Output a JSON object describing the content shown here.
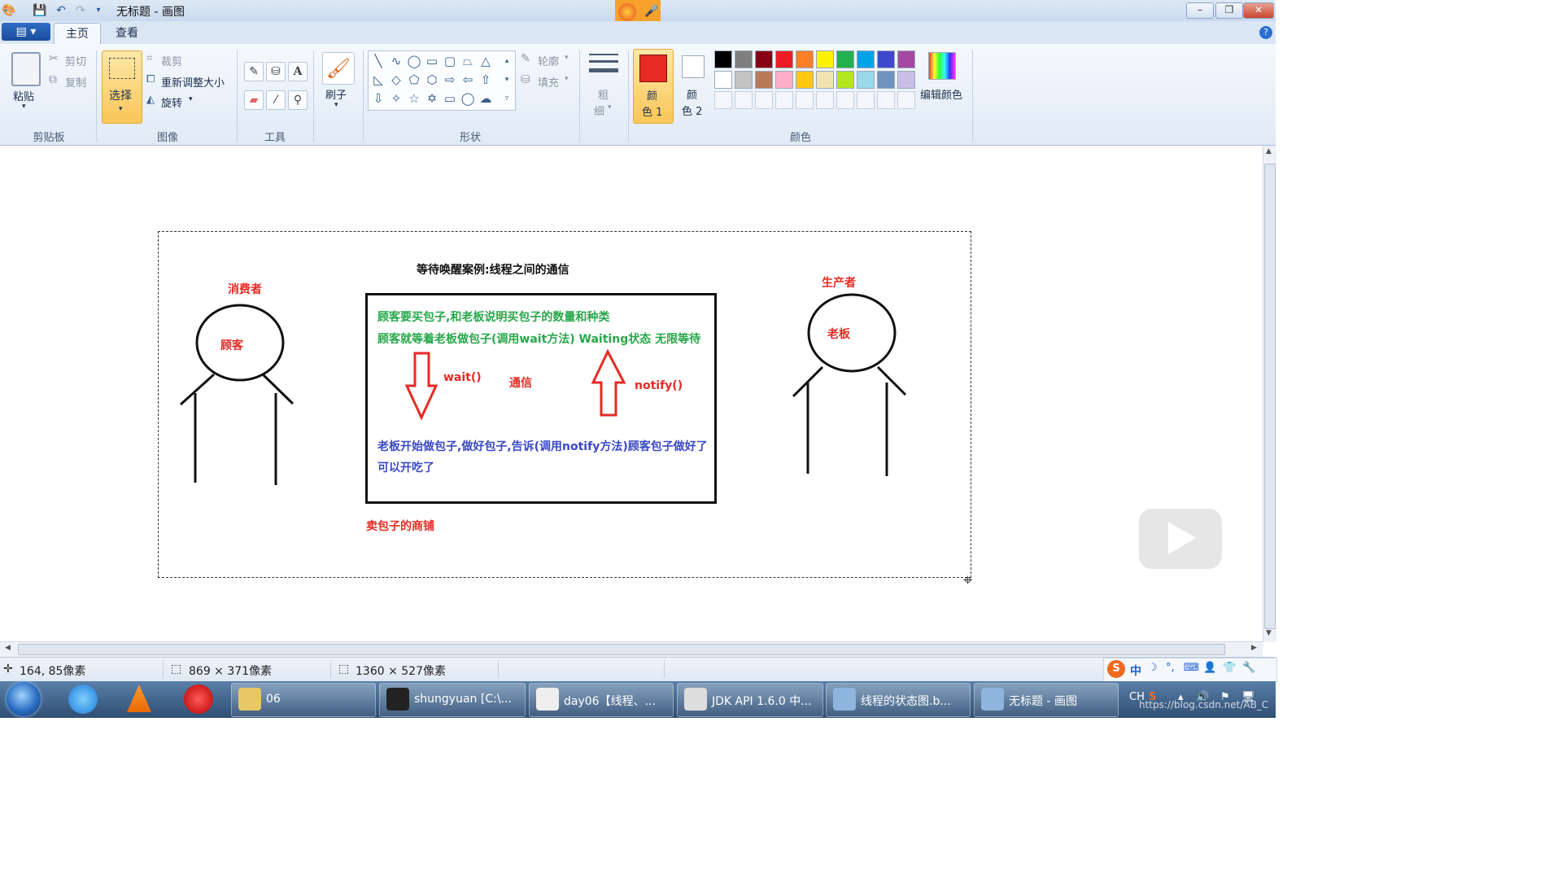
{
  "window": {
    "title": "无标题 - 画图",
    "controls": {
      "minimize": "–",
      "maximize": "❐",
      "close": "✕"
    }
  },
  "quick_access": {
    "icons": [
      "paint-app-icon",
      "save-icon",
      "undo-icon",
      "redo-icon",
      "customize-icon"
    ]
  },
  "ribbon_tabs": [
    {
      "label": "主页",
      "active": true
    },
    {
      "label": "查看",
      "active": false
    }
  ],
  "help_glyph": "?",
  "groups": {
    "clipboard": {
      "label": "剪贴板",
      "paste": "粘贴",
      "cut": "剪切",
      "copy": "复制"
    },
    "image": {
      "label": "图像",
      "select": "选择",
      "crop": "裁剪",
      "resize": "重新调整大小",
      "rotate": "旋转"
    },
    "tools": {
      "label": "工具"
    },
    "brushes": {
      "label": "刷子"
    },
    "shapes": {
      "label": "形状",
      "outline": "轮廓",
      "fill": "填充"
    },
    "size": {
      "label_top": "粗",
      "label_bottom": "细"
    },
    "colors": {
      "label": "颜色",
      "color1_top": "颜",
      "color1_bottom": "色 1",
      "color2_top": "颜",
      "color2_bottom": "色 2",
      "edit_colors": "编辑颜色",
      "color1_value": "#e52b24",
      "color2_value": "#ffffff",
      "palette_row1": [
        "#000000",
        "#7f7f7f",
        "#880015",
        "#ed1c24",
        "#ff7f27",
        "#fff200",
        "#22b14c",
        "#00a2e8",
        "#3f48cc",
        "#a349a4"
      ],
      "palette_row2": [
        "#ffffff",
        "#c3c3c3",
        "#b97a57",
        "#ffaec9",
        "#ffc90e",
        "#efe4b0",
        "#b5e61d",
        "#99d9ea",
        "#7092be",
        "#c8bfe7"
      ]
    }
  },
  "drawing": {
    "title": "等待唤醒案例:线程之间的通信",
    "consumer_label": "消费者",
    "consumer_name": "顾客",
    "producer_label": "生产者",
    "producer_name": "老板",
    "line1": "顾客要买包子,和老板说明买包子的数量和种类",
    "line2": "顾客就等着老板做包子(调用wait方法)  Waiting状态 无限等待",
    "wait_label": "wait()",
    "comm_label": "通信",
    "notify_label": "notify()",
    "line3": "老板开始做包子,做好包子,告诉(调用notify方法)顾客包子做好了",
    "line4": "可以开吃了",
    "shop_label": "卖包子的商铺",
    "colors": {
      "red": "#e52b24",
      "green": "#27a84a",
      "blue": "#3b49c4"
    }
  },
  "status": {
    "cursor_pos": "164, 85像素",
    "selection_size": "869 × 371像素",
    "image_size": "1360 × 527像素"
  },
  "ime": {
    "mode": "中"
  },
  "taskbar": {
    "items": [
      {
        "label": "06"
      },
      {
        "label": "shungyuan [C:\\..."
      },
      {
        "label": "day06【线程、..."
      },
      {
        "label": "JDK API 1.6.0 中..."
      },
      {
        "label": "线程的状态图.b..."
      },
      {
        "label": "无标题 - 画图"
      }
    ],
    "tray_lang": "CH",
    "watermark": "https://blog.csdn.net/AB_C"
  }
}
